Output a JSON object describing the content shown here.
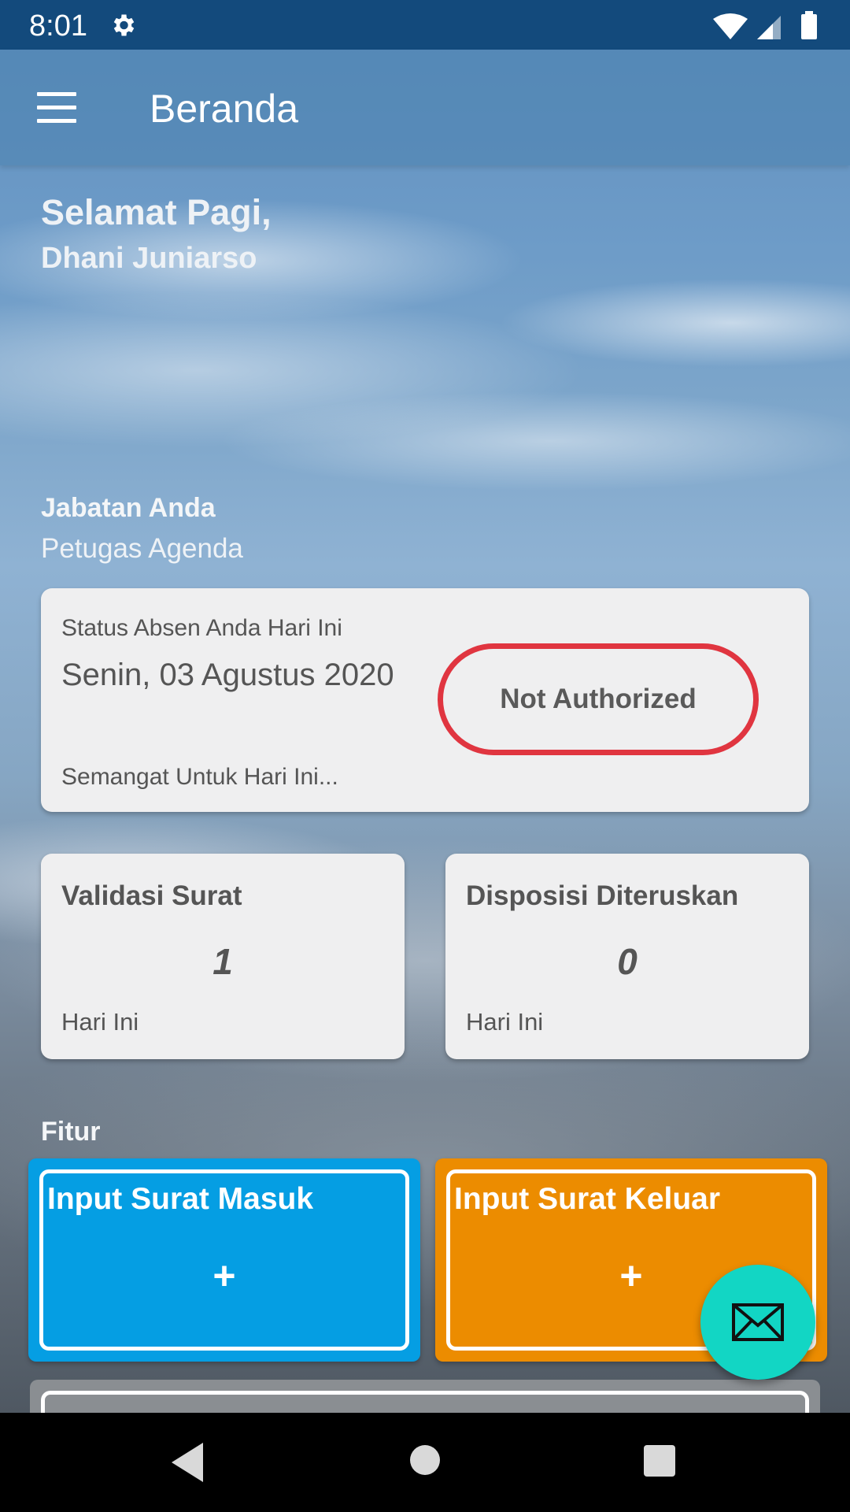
{
  "status_bar": {
    "time": "8:01"
  },
  "toolbar": {
    "title": "Beranda"
  },
  "greeting": {
    "salutation": "Selamat Pagi,",
    "name": "Dhani Juniarso"
  },
  "position": {
    "label": "Jabatan Anda",
    "value": "Petugas Agenda"
  },
  "attendance": {
    "title": "Status Absen Anda Hari Ini",
    "date": "Senin, 03 Agustus 2020",
    "status": "Not Authorized",
    "footer": "Semangat Untuk Hari Ini..."
  },
  "stats": [
    {
      "title": "Validasi Surat",
      "value": "1",
      "sub": "Hari Ini"
    },
    {
      "title": "Disposisi Diteruskan",
      "value": "0",
      "sub": "Hari Ini"
    }
  ],
  "features": {
    "label": "Fitur",
    "items": [
      {
        "title": "Input Surat Masuk",
        "plus": "+",
        "color": "#059ee3"
      },
      {
        "title": "Input Surat Keluar",
        "plus": "+",
        "color": "#ec8c00"
      }
    ]
  },
  "colors": {
    "status_bar": "#134a7c",
    "badge_border": "#e03540",
    "fab": "#12d6c4"
  },
  "icons": {
    "menu": "menu-icon",
    "settings": "gear-icon",
    "wifi": "wifi-icon",
    "signal": "signal-icon",
    "battery": "battery-icon",
    "fab": "mail-icon",
    "nav_back": "back-icon",
    "nav_home": "home-icon",
    "nav_recent": "recent-apps-icon"
  }
}
